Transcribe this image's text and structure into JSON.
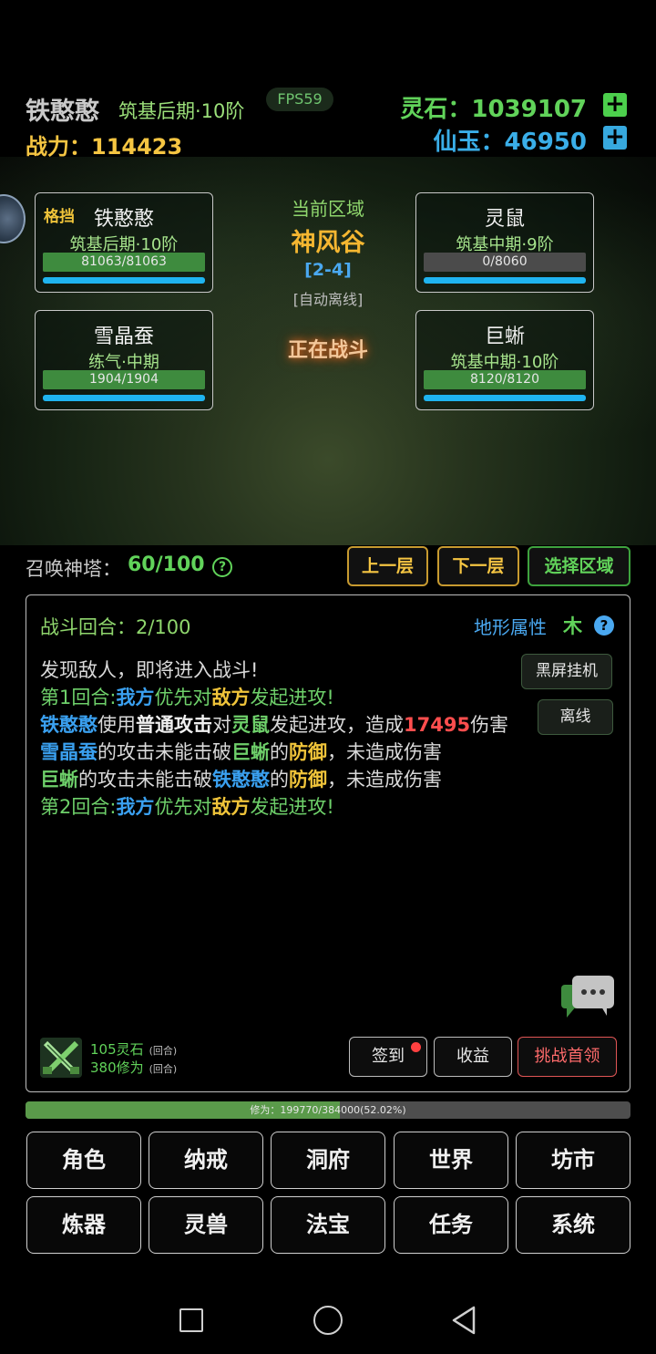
{
  "header": {
    "player_name": "铁憨憨",
    "player_realm": "筑基后期·10阶",
    "fps": "FPS59",
    "power": "战力：114423",
    "spirit_stones": "灵石：1039107",
    "jade": "仙玉：46950",
    "plus_symbol": "+"
  },
  "battle": {
    "allies": [
      {
        "tag": "格挡",
        "name": "铁憨憨",
        "realm": "筑基后期·10阶",
        "hp_text": "81063/81063",
        "hp_fraction": 1.0
      },
      {
        "tag": "",
        "name": "雪晶蚕",
        "realm": "练气·中期",
        "hp_text": "1904/1904",
        "hp_fraction": 1.0
      }
    ],
    "enemies": [
      {
        "name": "灵鼠",
        "realm": "筑基中期·9阶",
        "hp_text": "0/8060",
        "hp_fraction": 0.0
      },
      {
        "name": "巨蜥",
        "realm": "筑基中期·10阶",
        "hp_text": "8120/8120",
        "hp_fraction": 1.0
      }
    ],
    "zone_label": "当前区域",
    "zone_name": "神风谷",
    "zone_stage": "[2-4]",
    "zone_mode": "[自动离线]",
    "status": "正在战斗"
  },
  "tower": {
    "label": "召唤神塔：",
    "value": "60/100",
    "help": "?",
    "prev_floor": "上一层",
    "next_floor": "下一层",
    "select_zone": "选择区域"
  },
  "log": {
    "round_counter": "战斗回合：2/100",
    "terrain_label": "地形属性",
    "terrain_value": "木",
    "terrain_help": "?",
    "black_screen_btn": "黑屏挂机",
    "offline_btn": "离线",
    "lines": {
      "l1": "发现敌人，即将进入战斗!",
      "l2": {
        "a": "第1回合:",
        "b": "我方",
        "c": "优先对",
        "d": "敌方",
        "e": "发起进攻!"
      },
      "l3": {
        "a": "铁憨憨",
        "b": "使用",
        "c": "普通攻击",
        "d": "对",
        "e": "灵鼠",
        "f": "发起进攻，造成",
        "g": "17495",
        "h": "伤害"
      },
      "l4": {
        "a": "雪晶蚕",
        "b": "的攻击未能击破",
        "c": "巨蜥",
        "d": "的",
        "e": "防御",
        "f": "，未造成伤害"
      },
      "l5": {
        "a": "巨蜥",
        "b": "的攻击未能击破",
        "c": "铁憨憨",
        "d": "的",
        "e": "防御",
        "f": "，未造成伤害"
      },
      "l6": {
        "a": "第2回合:",
        "b": "我方",
        "c": "优先对",
        "d": "敌方",
        "e": "发起进攻!"
      }
    },
    "rewards": {
      "r1": "105灵石",
      "r1_sub": "(回合)",
      "r2": "380修为",
      "r2_sub": "(回合)"
    },
    "checkin_btn": "签到",
    "income_btn": "收益",
    "boss_btn": "挑战首领"
  },
  "cultivation": {
    "text": "修为：199770/384000(52.02%)",
    "fraction": 0.5202
  },
  "menu": {
    "row1": [
      "角色",
      "纳戒",
      "洞府",
      "世界",
      "坊市"
    ],
    "row2": [
      "炼器",
      "灵兽",
      "法宝",
      "任务",
      "系统"
    ]
  },
  "colors": {
    "gold": "#f5c542",
    "green": "#61d35a",
    "blue": "#3aa0f0",
    "red": "#ff4e4e",
    "hp_green": "#3e8b3e",
    "mp_blue": "#1fb4f0"
  },
  "icons": {
    "chat": "chat-bubble-icon",
    "reward": "crossed-swords-icon",
    "nav": [
      "square-recent-icon",
      "circle-home-icon",
      "triangle-back-icon"
    ]
  }
}
